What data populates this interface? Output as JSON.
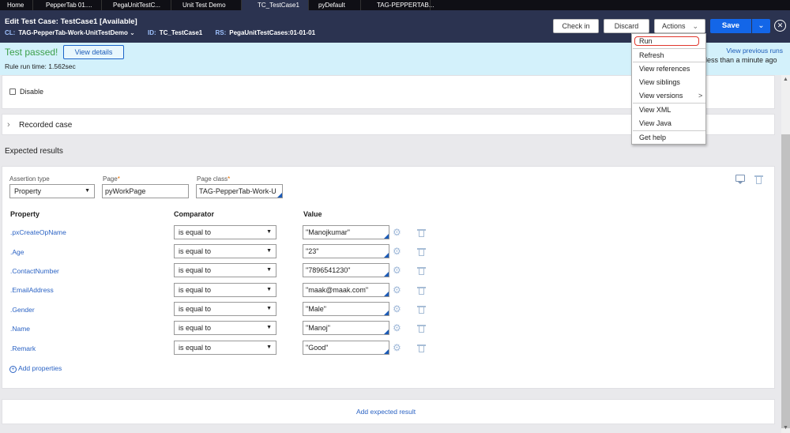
{
  "tabs": [
    "Home",
    "PepperTab 01....",
    "PegaUnitTestC...",
    "Unit Test Demo",
    "TC_TestCase1",
    "pyDefault",
    "TAG-PEPPERTAB..."
  ],
  "header": {
    "title": "Edit  Test Case: TestCase1 [Available]",
    "cl_key": "CL:",
    "cl_value": "TAG-PepperTab-Work-UnitTestDemo",
    "id_key": "ID:",
    "id_value": "TC_TestCase1",
    "rs_key": "RS:",
    "rs_value": "PegaUnitTestCases:01-01-01",
    "checkin_label": "Check in",
    "discard_label": "Discard",
    "actions_label": "Actions",
    "save_label": "Save"
  },
  "banner": {
    "status": "Test passed!",
    "view_details": "View details",
    "rule_run_time": "Rule run time:  1.562sec",
    "view_previous_runs": "View previous runs",
    "last_run": "less than a minute ago"
  },
  "actions_menu": [
    "Run",
    "Refresh",
    "View references",
    "View siblings",
    "View versions",
    "View XML",
    "View Java",
    "Get help"
  ],
  "disable_label": "Disable",
  "recorded_case_label": "Recorded case",
  "expected_results": {
    "title": "Expected results",
    "assertion_type_label": "Assertion type",
    "assertion_type_value": "Property",
    "page_label": "Page",
    "page_value": "pyWorkPage",
    "page_class_label": "Page class",
    "page_class_value": "TAG-PepperTab-Work-U",
    "col_property": "Property",
    "col_comparator": "Comparator",
    "col_value": "Value",
    "rows": [
      {
        "property": ".pxCreateOpName",
        "comparator": "is equal to",
        "value": "\"Manojkumar\""
      },
      {
        "property": ".Age",
        "comparator": "is equal to",
        "value": "\"23\""
      },
      {
        "property": ".ContactNumber",
        "comparator": "is equal to",
        "value": "\"7896541230\""
      },
      {
        "property": ".EmailAddress",
        "comparator": "is equal to",
        "value": "\"maak@maak.com\""
      },
      {
        "property": ".Gender",
        "comparator": "is equal to",
        "value": "\"Male\""
      },
      {
        "property": ".Name",
        "comparator": "is equal to",
        "value": "\"Manoj\""
      },
      {
        "property": ".Remark",
        "comparator": "is equal to",
        "value": "\"Good\""
      }
    ],
    "add_properties": "Add properties",
    "add_expected_result": "Add expected result"
  },
  "colors": {
    "header_bg": "#2b3350",
    "banner_bg": "#d3f1fb",
    "pass_green": "#3da04a",
    "link_blue": "#2b63c4",
    "save_blue": "#1366e8",
    "run_highlight": "#e0362c"
  }
}
